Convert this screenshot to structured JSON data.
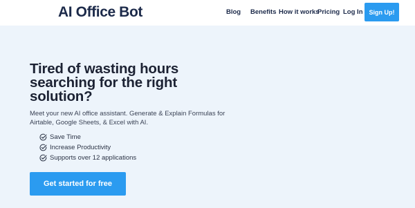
{
  "header": {
    "logo_text": "AI Office Bot",
    "nav": {
      "blog": "Blog",
      "benefits": "Benefits",
      "how_it_works": "How it works",
      "pricing": "Pricing",
      "login": "Log In"
    },
    "signup_label": "Sign Up!"
  },
  "hero": {
    "headline": "Tired of wasting hours searching for the right solution?",
    "description": "Meet your new AI office assistant. Generate & Explain Formulas for Airtable, Google Sheets, & Excel with AI.",
    "features": [
      "Save Time",
      "Increase Productivity",
      "Supports over 12 applications"
    ],
    "cta_label": "Get started for free"
  },
  "colors": {
    "accent": "#2b9bf0",
    "hero_background": "#edf4fb",
    "logo": "#1c2a4a",
    "headline": "#1c2233"
  },
  "icons": {
    "feature_check": "check-circle-icon"
  }
}
